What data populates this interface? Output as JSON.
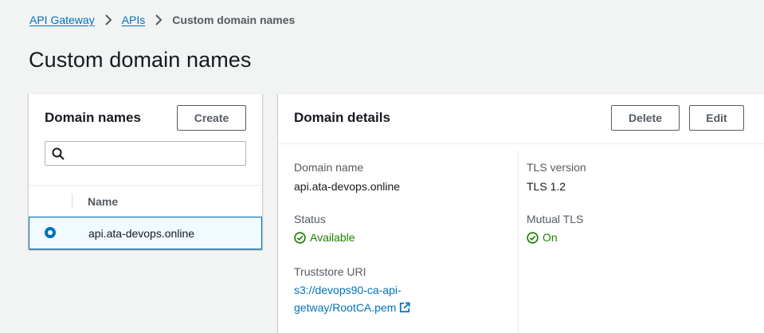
{
  "breadcrumb": {
    "items": [
      "API Gateway",
      "APIs"
    ],
    "current": "Custom domain names"
  },
  "page": {
    "title": "Custom domain names"
  },
  "domain_names": {
    "title": "Domain names",
    "create_label": "Create",
    "search_placeholder": "",
    "column_name": "Name",
    "rows": [
      {
        "name": "api.ata-devops.online",
        "selected": true
      }
    ]
  },
  "details": {
    "title": "Domain details",
    "delete_label": "Delete",
    "edit_label": "Edit",
    "domain_name_label": "Domain name",
    "domain_name_value": "api.ata-devops.online",
    "status_label": "Status",
    "status_value": "Available",
    "truststore_label": "Truststore URI",
    "truststore_line1": "s3://devops90-ca-api-",
    "truststore_line2": "getway/RootCA.pem",
    "tls_label": "TLS version",
    "tls_value": "TLS 1.2",
    "mtls_label": "Mutual TLS",
    "mtls_value": "On"
  },
  "icons": {
    "breadcrumb_separator": "chevron-right-icon",
    "search": "search-icon",
    "status": "check-circle-icon",
    "external": "external-link-icon"
  },
  "colors": {
    "link": "#0073bb",
    "success": "#1d8102",
    "selected_bg": "#f1faff"
  }
}
